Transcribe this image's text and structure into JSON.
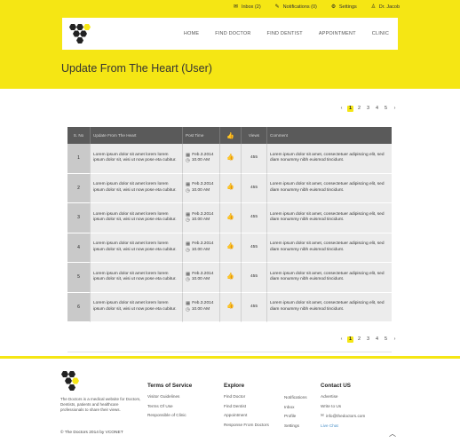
{
  "topbar": {
    "items": [
      {
        "icon": "inbox-icon",
        "label": "Inbox (2)"
      },
      {
        "icon": "notification-icon",
        "label": "Notifications (0)"
      },
      {
        "icon": "settings-icon",
        "label": "Settings"
      },
      {
        "icon": "user-icon",
        "label": "Dr. Jacob"
      }
    ]
  },
  "nav": {
    "links": [
      "HOME",
      "FIND DOCTOR",
      "FIND DENTIST",
      "APPOINTMENT",
      "CLINIC"
    ]
  },
  "page": {
    "title": "Update From The Heart (User)"
  },
  "pagination": {
    "prev": "‹",
    "pages": [
      "1",
      "2",
      "3",
      "4",
      "5"
    ],
    "next": "›",
    "active": "1"
  },
  "table": {
    "headers": [
      "S. No",
      "Update From The Heart",
      "Post Time",
      "",
      "Views",
      "Comment"
    ],
    "rows": [
      {
        "num": "1",
        "subject": "Lorem ipsum dolor sit amet lorem lorem ipsum dolor sit, wisi ut now pose eta cubitur.",
        "date": "Feb.3.2014",
        "time": "10.00 AM",
        "views": "455",
        "comment": "Lorem ipsum dolor sit amet, consectetuer adipiscing elit, sed diam nonummy nibh euismod tincidunt."
      },
      {
        "num": "2",
        "subject": "Lorem ipsum dolor sit amet lorem lorem ipsum dolor sit, wisi ut now pose eta cubitur.",
        "date": "Feb.3.2014",
        "time": "10.00 AM",
        "views": "455",
        "comment": "Lorem ipsum dolor sit amet, consectetuer adipiscing elit, sed diam nonummy nibh euismod tincidunt."
      },
      {
        "num": "3",
        "subject": "Lorem ipsum dolor sit amet lorem lorem ipsum dolor sit, wisi ut now pose eta cubitur.",
        "date": "Feb.3.2014",
        "time": "10.00 AM",
        "views": "455",
        "comment": "Lorem ipsum dolor sit amet, consectetuer adipiscing elit, sed diam nonummy nibh euismod tincidunt."
      },
      {
        "num": "4",
        "subject": "Lorem ipsum dolor sit amet lorem lorem ipsum dolor sit, wisi ut now pose eta cubitur.",
        "date": "Feb.3.2014",
        "time": "10.00 AM",
        "views": "455",
        "comment": "Lorem ipsum dolor sit amet, consectetuer adipiscing elit, sed diam nonummy nibh euismod tincidunt."
      },
      {
        "num": "5",
        "subject": "Lorem ipsum dolor sit amet lorem lorem ipsum dolor sit, wisi ut now pose eta cubitur.",
        "date": "Feb.3.2014",
        "time": "10.00 AM",
        "views": "455",
        "comment": "Lorem ipsum dolor sit amet, consectetuer adipiscing elit, sed diam nonummy nibh euismod tincidunt."
      },
      {
        "num": "6",
        "subject": "Lorem ipsum dolor sit amet lorem lorem ipsum dolor sit, wisi ut now pose eta cubitur.",
        "date": "Feb.3.2014",
        "time": "10.00 AM",
        "views": "455",
        "comment": "Lorem ipsum dolor sit amet, consectetuer adipiscing elit, sed diam nonummy nibh euismod tincidunt."
      }
    ]
  },
  "footer": {
    "about": "The Doctors is a medical website for Doctors, Dentists, patients and healthcare professionals to share their views.",
    "copyright": "© The Doctors 2014 by VCONET",
    "tos": {
      "title": "Terms of Service",
      "links": [
        "Visitor Guidelines",
        "Terms Of Use",
        "Responsible of Clinic"
      ]
    },
    "explore": {
      "title": "Explore",
      "links": [
        "Find Doctor",
        "Find Dentist",
        "Appointment",
        "Response From Doctors"
      ]
    },
    "explore2": {
      "links": [
        "Notifications",
        "Inbox",
        "Profile",
        "Settings"
      ]
    },
    "contact": {
      "title": "Contact US",
      "links": [
        "Advertise",
        "Write to Us",
        "info@thedoctors.com",
        "Live Chat"
      ]
    }
  },
  "colors": {
    "accent": "#f5e614",
    "table_header": "#5a5a5a",
    "row_bg": "#ececec"
  }
}
